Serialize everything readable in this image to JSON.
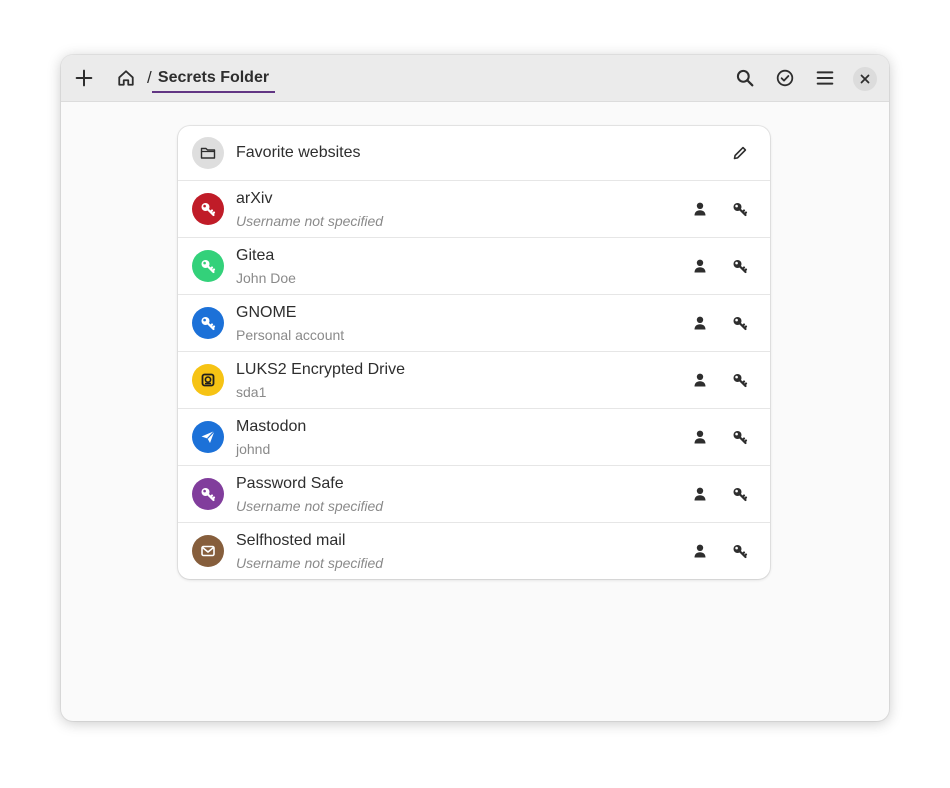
{
  "header": {
    "new_icon": "plus-icon",
    "home_icon": "home-icon",
    "breadcrumb_separator": "/",
    "title": "Secrets Folder",
    "search_icon": "search-icon",
    "select_icon": "check-circle-icon",
    "menu_icon": "hamburger-menu-icon",
    "close_icon": "close-icon",
    "accent_color": "#613583"
  },
  "folder": {
    "name": "Favorite websites",
    "icon": "folder-icon",
    "edit_icon": "pencil-icon"
  },
  "entries": [
    {
      "title": "arXiv",
      "subtitle": "Username not specified",
      "subtitle_italic": true,
      "color": "#c01c28",
      "icon": "key-icon"
    },
    {
      "title": "Gitea",
      "subtitle": "John Doe",
      "subtitle_italic": false,
      "color": "#33d17a",
      "icon": "key-icon"
    },
    {
      "title": "GNOME",
      "subtitle": "Personal account",
      "subtitle_italic": false,
      "color": "#1c71d8",
      "icon": "key-icon"
    },
    {
      "title": "LUKS2 Encrypted Drive",
      "subtitle": "sda1",
      "subtitle_italic": false,
      "color": "#f6c314",
      "icon": "drive-icon"
    },
    {
      "title": "Mastodon",
      "subtitle": "johnd",
      "subtitle_italic": false,
      "color": "#1c71d8",
      "icon": "send-icon"
    },
    {
      "title": "Password Safe",
      "subtitle": "Username not specified",
      "subtitle_italic": true,
      "color": "#813d9c",
      "icon": "key-icon"
    },
    {
      "title": "Selfhosted mail",
      "subtitle": "Username not specified",
      "subtitle_italic": true,
      "color": "#865e3c",
      "icon": "mail-icon"
    }
  ],
  "row_actions": {
    "copy_username_icon": "person-icon",
    "copy_password_icon": "key-icon"
  }
}
